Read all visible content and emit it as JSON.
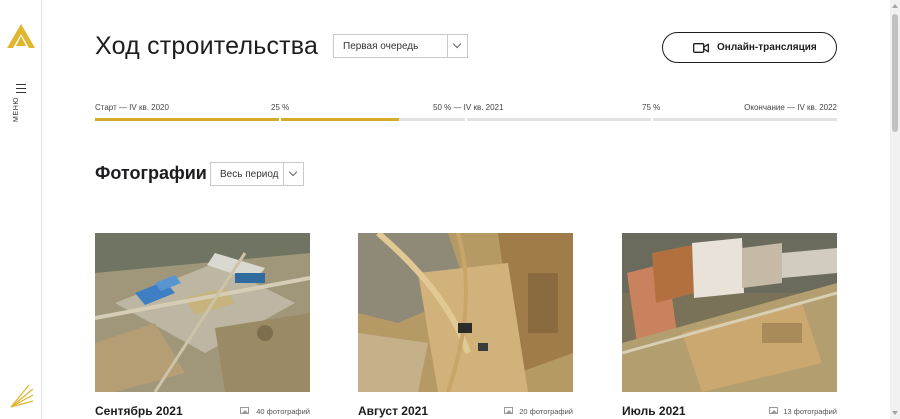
{
  "sidebar": {
    "menu_label": "МЕНЮ",
    "logo_icon": "brand-chevron-logo",
    "bottom_icon": "brand-rays-icon",
    "brand_color": "#e0b62f"
  },
  "header": {
    "title": "Ход строительства",
    "stage_select": {
      "value": "Первая очередь"
    },
    "live_button": {
      "label": "Онлайн-трансляция",
      "icon": "video-camera-icon"
    }
  },
  "progress": {
    "accent_color": "#d4ac2c",
    "completed_fraction": 0.41,
    "milestones": [
      {
        "label": "Старт — IV кв. 2020"
      },
      {
        "label": "25 %"
      },
      {
        "label": "50 % — IV кв. 2021"
      },
      {
        "label": "75 %"
      },
      {
        "label": "Окончание — IV кв. 2022"
      }
    ]
  },
  "photos": {
    "title": "Фотографии",
    "period_select": {
      "value": "Весь период"
    },
    "cards": [
      {
        "month": "Сентябрь 2021",
        "count": "40 фотографий"
      },
      {
        "month": "Август 2021",
        "count": "20 фотографий"
      },
      {
        "month": "Июль 2021",
        "count": "13 фотографий"
      }
    ]
  }
}
